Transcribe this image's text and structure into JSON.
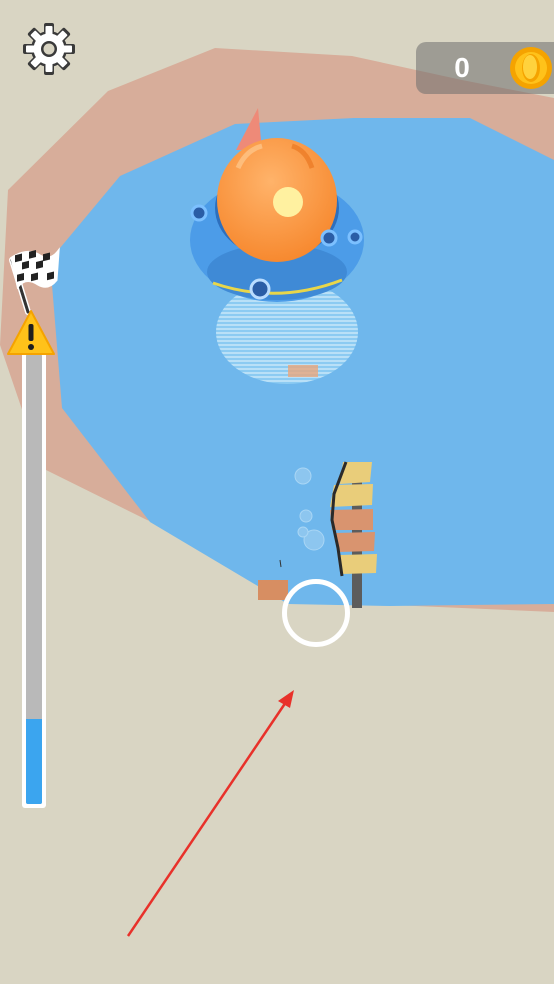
{
  "hud": {
    "coins": "0",
    "settings_icon": "gear-icon",
    "coin_icon": "coin-icon"
  },
  "progress": {
    "fill_fraction": 0.19,
    "flag_icon": "checkered-flag-icon",
    "warning_icon": "warning-icon"
  },
  "scene": {
    "ground_color": "#d9d5c3",
    "water_color": "#6fb7ec",
    "rim_color": "#d7ad9a",
    "boat_color": "#4c9ce8",
    "dome_color": "#fb9c45",
    "aim_arrow_color": "#e8312a"
  }
}
